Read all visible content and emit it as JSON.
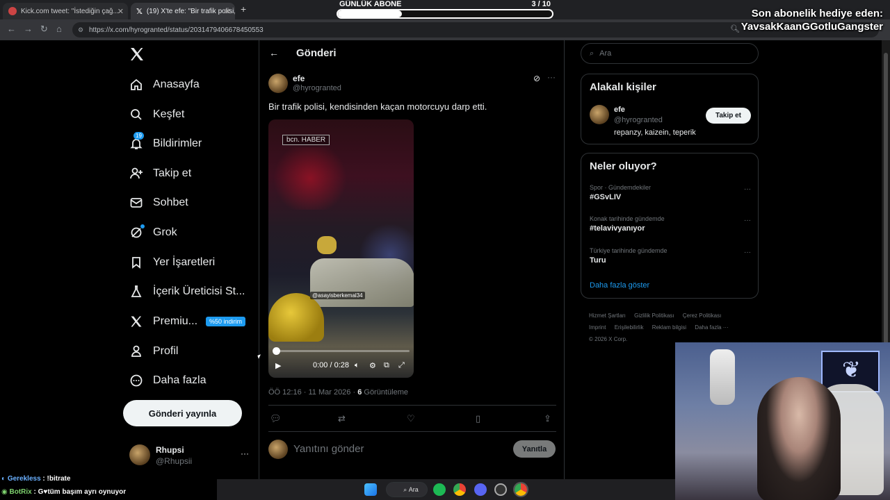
{
  "browser": {
    "tabs": [
      {
        "label": "Kick.com  tweet: \"İstediğin çağ..."
      },
      {
        "label": "(19) X'te efe: \"Bir trafik polisi, k..."
      }
    ],
    "url": "https://x.com/hyrogranted/status/2031479406678450553"
  },
  "overlay": {
    "goal_label": "GÜNLÜK ABONE",
    "goal_count": "3  / 10",
    "goal_progress": 0.3,
    "gift_line1": "Son abonelik hediye eden:",
    "gift_line2": "YavsakKaanGGotluGangster"
  },
  "nav": {
    "items": [
      {
        "label": "Anasayfa",
        "icon": "home-icon"
      },
      {
        "label": "Keşfet",
        "icon": "search-icon"
      },
      {
        "label": "Bildirimler",
        "icon": "bell-icon",
        "badge": "19"
      },
      {
        "label": "Takip et",
        "icon": "add-person-icon"
      },
      {
        "label": "Sohbet",
        "icon": "mail-icon"
      },
      {
        "label": "Grok",
        "icon": "grok-icon"
      },
      {
        "label": "Yer İşaretleri",
        "icon": "bookmark-icon"
      },
      {
        "label": "İçerik Üreticisi St...",
        "icon": "flask-icon"
      },
      {
        "label": "Premiu...",
        "icon": "x-icon",
        "badge": "%50 indirim"
      },
      {
        "label": "Profil",
        "icon": "person-icon"
      },
      {
        "label": "Daha fazla",
        "icon": "more-circle-icon"
      }
    ],
    "post_button": "Gönderi yayınla",
    "account": {
      "name": "Rhupsi",
      "handle": "@Rhupsii",
      "more": "···"
    }
  },
  "post": {
    "page_title": "Gönderi",
    "author_name": "efe",
    "author_handle": "@hyrogranted",
    "more": "···",
    "text": "Bir trafik polisi, kendisinden kaçan motorcuyu darp etti.",
    "video": {
      "watermark": "bcn. HABER",
      "tag": "@asayisberkemal34",
      "time": "0:00 / 0:28",
      "progress": 0.0
    },
    "meta_time": "ÖÖ 12:16 · 11 Mar 2026 · ",
    "views_count": "6",
    "views_label": " Görüntüleme",
    "reply_placeholder": "Yanıtını gönder",
    "reply_button": "Yanıtla"
  },
  "sidebar": {
    "search_placeholder": "Ara",
    "related_title": "Alakalı kişiler",
    "related": {
      "name": "efe",
      "handle": "@hyrogranted",
      "bio": "repanzy, kaizein, teperik",
      "follow": "Takip et"
    },
    "trending_title": "Neler oluyor?",
    "trends": [
      {
        "context": "Spor · Gündemdekiler",
        "title": "#GSvLIV"
      },
      {
        "context": "Konak tarihinde gündemde",
        "title": "#telavivyanıyor"
      },
      {
        "context": "Türkiye tarihinde gündemde",
        "title": "Turu"
      }
    ],
    "trend_more": "···",
    "show_more": "Daha fazla göster",
    "footer": [
      "Hizmet Şartları",
      "Gizlilik Politikası",
      "Çerez Politikası",
      "Imprint",
      "Erişilebilirlik",
      "Reklam bilgisi",
      "Daha fazla ···",
      "© 2026 X Corp."
    ]
  },
  "chat": [
    {
      "user": "Gerekless",
      "msg": " : !bitrate"
    },
    {
      "user": "BotRix",
      "msg": " : G♥tüm başım ayrı oynuyor"
    }
  ],
  "taskbar": {
    "search": "Ara"
  },
  "colors": {
    "accent": "#1d9bf0",
    "background": "#000000",
    "border": "#2f3336",
    "muted": "#71767b"
  }
}
